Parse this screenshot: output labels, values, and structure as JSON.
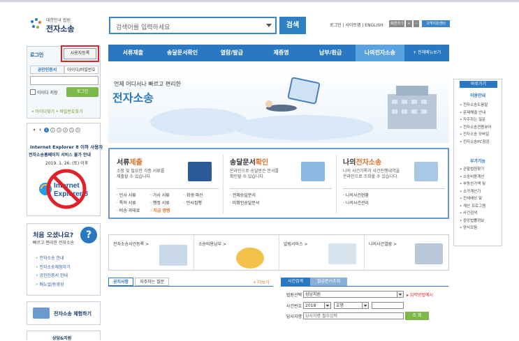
{
  "header": {
    "logo_small": "대한민국 법원",
    "logo_big": "전자소송",
    "search_placeholder": "검색어를 입력하세요",
    "search_button": "검색",
    "top_links": "로그인 | 사이트맵 | ENGLISH",
    "font_small": "화면크기",
    "customer_center": "고객지원센터"
  },
  "nav": {
    "items": [
      "서류제출",
      "송달문서확인",
      "열람/발급",
      "제증명",
      "납부/환급",
      "나의전자소송"
    ],
    "all_menu": "+ 전체메뉴보기"
  },
  "login": {
    "label": "로그인",
    "register_button": "사용자등록",
    "tab_cert": "공인인증서",
    "tab_id": "아이디/비밀번호",
    "save_id": "아이디 저장",
    "login_button": "로그인",
    "find_links": "• 아이디찾기 • 비밀번호찾기"
  },
  "ie_notice": {
    "pager": [
      "1",
      "2",
      "3",
      "4",
      "5",
      "6"
    ],
    "line1": "Internet Explorer 8 이하 사용자",
    "line2": "전자소송홈페이지 서비스 불가 안내",
    "line3": "2019. 1. 26. (토) 이후"
  },
  "first_visit": {
    "title": "처음 오셨나요?",
    "subtitle": "빠르고 편리한 전자소송",
    "links": [
      "전자소송 안내",
      "전자소송체험하기",
      "공인인증서 안내",
      "매뉴얼/동영상"
    ]
  },
  "experience": {
    "title": "전자소송 체험하기"
  },
  "more_box": {
    "title": "상담&지원"
  },
  "hero": {
    "sub": "언제 어디서나 빠르고 편리한",
    "title": "전자소송"
  },
  "services": [
    {
      "title_a": "서류",
      "title_b": "제출",
      "desc": [
        "소장 및 필요한 각종 서류를",
        "제출할 수 있습니다."
      ],
      "links": [
        "· 민사 서류",
        "· 가사 서류",
        "· 회생·파산",
        "· 특허 서류",
        "· 행정 서류",
        "· 민사집행",
        "· 비송·과태료",
        "· 지급 명령"
      ]
    },
    {
      "title_a": "송달문서",
      "title_b": "확인",
      "desc": [
        "온라인으로 송달받은 문서를",
        "확인할 수 있습니다."
      ],
      "links": [
        "· 전체송달문서",
        "· 미확인송달문서"
      ]
    },
    {
      "title_a": "나의",
      "title_b": "전자소송",
      "desc": [
        "나의 사건기록과 사건진행내역을",
        "온라인으로 조회할 수 있습니다."
      ],
      "links": [
        "· 나의사건현황",
        "· 나의사건관리"
      ]
    }
  ],
  "quick": [
    "전자소송사건등록 >",
    "소송비용납부 >",
    "알림서비스 >",
    "나의사건열람 >"
  ],
  "notice": {
    "tabs": [
      "공지사항",
      "자주하는 질문"
    ],
    "more": "+ 더보기"
  },
  "case_search": {
    "tabs": [
      "사건검색",
      "발급문서조회"
    ],
    "court_label": "법원선택",
    "court_value": "성남지원",
    "method_link": "▸ 입력방법예시",
    "case_no_label": "사건번호",
    "year_value": "2018",
    "type_value": "호명",
    "party_label": "당사자명",
    "party_value": "당사자명 필수입력",
    "search_button": "조 회"
  },
  "right": {
    "head": "바로가기",
    "sec1": "이용안내",
    "list1": [
      "전자소송도움말",
      "문제해결 안내",
      "자주하는 질문",
      "전자소송전용뷰어",
      "전자소송 모바일",
      "전자소송PC점검"
    ],
    "sec2": "부가기능",
    "list2": [
      "관할법원찾기",
      "소송비용계산",
      "부동산가액 및",
      "소가계산기",
      "전세배상 및",
      "계산 프로그램",
      "사건검색",
      "중앙법률정보",
      "양식모음"
    ]
  }
}
